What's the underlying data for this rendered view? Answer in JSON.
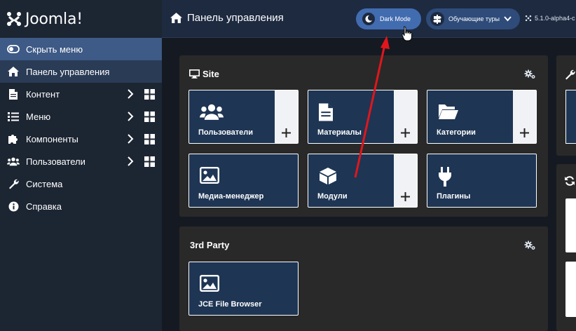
{
  "brand": {
    "name": "Joomla!",
    "logo_icon": "joomla-logo-icon"
  },
  "sidebar": {
    "items": [
      {
        "label": "Скрыть меню",
        "icon": "toggle-icon"
      },
      {
        "label": "Панель управления",
        "icon": "home-icon"
      },
      {
        "label": "Контент",
        "icon": "file-icon"
      },
      {
        "label": "Меню",
        "icon": "list-icon"
      },
      {
        "label": "Компоненты",
        "icon": "puzzle-icon"
      },
      {
        "label": "Пользователи",
        "icon": "users-icon"
      },
      {
        "label": "Система",
        "icon": "wrench-icon"
      },
      {
        "label": "Справка",
        "icon": "info-icon"
      }
    ]
  },
  "header": {
    "title": "Панель управления",
    "dark_mode_label": "Dark Mode",
    "tours_label": "Обучающие туры",
    "version": "5.1.0-alpha4-c"
  },
  "site_card": {
    "title": "Site",
    "tiles": [
      {
        "label": "Пользователи",
        "icon": "users-icon",
        "has_add": true
      },
      {
        "label": "Материалы",
        "icon": "file-icon",
        "has_add": true
      },
      {
        "label": "Категории",
        "icon": "folder-open-icon",
        "has_add": true
      },
      {
        "label": "Медиа-менеджер",
        "icon": "image-icon",
        "has_add": false
      },
      {
        "label": "Модули",
        "icon": "cube-icon",
        "has_add": true
      },
      {
        "label": "Плагины",
        "icon": "plug-icon",
        "has_add": false
      }
    ]
  },
  "third_party_card": {
    "title": "3rd Party",
    "tiles": [
      {
        "label": "JCE File Browser",
        "icon": "image-icon",
        "has_add": false
      }
    ]
  },
  "colors": {
    "sidebar_bg": "#1c2532",
    "header_bg": "#1d2a40",
    "tile_bg": "#1e3554",
    "dark_mode_btn": "#426cb0",
    "annotation_arrow": "#e0161c"
  }
}
